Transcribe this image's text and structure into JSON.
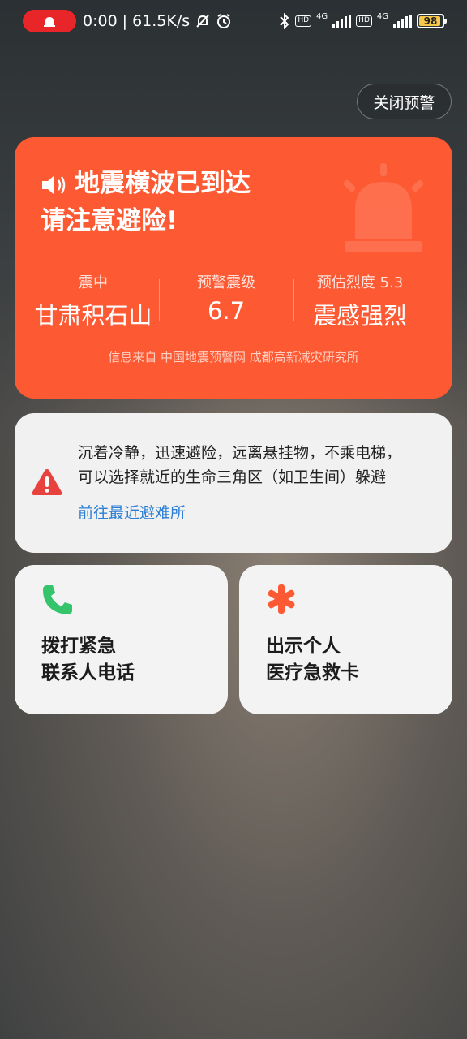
{
  "status_bar": {
    "time": "0:00",
    "net_speed": "61.5K/s",
    "hd_badge": "HD",
    "network_type": "4G",
    "battery_level": "98"
  },
  "header": {
    "close_alert_label": "关闭预警"
  },
  "alert": {
    "title_line1": "地震横波已到达",
    "title_line2": "请注意避险!",
    "epicenter_label": "震中",
    "epicenter_value": "甘肃积石山",
    "magnitude_label": "预警震级",
    "magnitude_value": "6.7",
    "intensity_label": "预估烈度 5.3",
    "intensity_value": "震感强烈",
    "source": "信息来自 中国地震预警网 成都高新减灾研究所",
    "color": "#fd5a33"
  },
  "advice": {
    "line1": "沉着冷静，迅速避险，远离悬挂物，不乘电梯，",
    "line2": "可以选择就近的生命三角区（如卫生间）躲避",
    "link": "前往最近避难所"
  },
  "actions": {
    "call_label": "拨打紧急\n联系人电话",
    "medical_label": "出示个人\n医疗急救卡"
  },
  "icons": [
    "alarm-icon",
    "mute-bell-icon",
    "clock-icon",
    "bluetooth-icon",
    "speaker-icon",
    "siren-icon",
    "warning-icon",
    "phone-icon",
    "asterisk-icon"
  ]
}
